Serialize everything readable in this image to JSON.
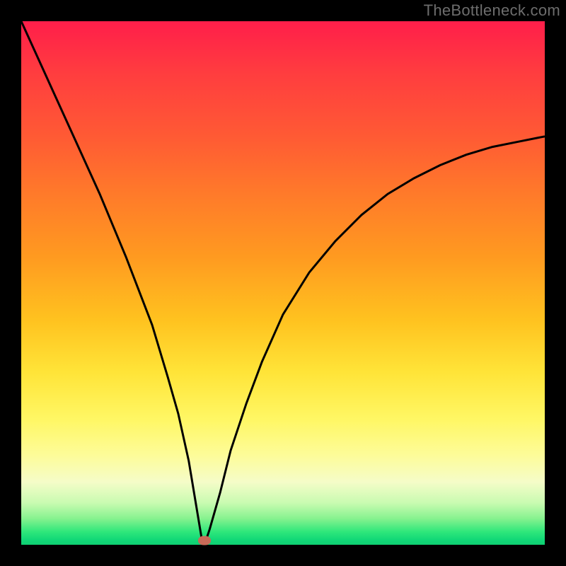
{
  "watermark": {
    "text": "TheBottleneck.com"
  },
  "colors": {
    "page_bg": "#000000",
    "watermark": "#6d6d6d",
    "curve": "#000000",
    "marker": "#c86a58",
    "gradient_top": "#ff1e4a",
    "gradient_bottom": "#0fcf72"
  },
  "chart_data": {
    "type": "line",
    "title": "",
    "xlabel": "",
    "ylabel": "",
    "xlim": [
      0,
      100
    ],
    "ylim": [
      0,
      100
    ],
    "grid": false,
    "legend": false,
    "series": [
      {
        "name": "curve",
        "x": [
          0,
          5,
          10,
          15,
          20,
          25,
          28,
          30,
          32,
          33,
          34,
          34.5,
          35,
          36,
          38,
          40,
          43,
          46,
          50,
          55,
          60,
          65,
          70,
          75,
          80,
          85,
          90,
          95,
          100
        ],
        "values": [
          100,
          89,
          78,
          67,
          55,
          42,
          32,
          25,
          16,
          10,
          4,
          1,
          0,
          3,
          10,
          18,
          27,
          35,
          44,
          52,
          58,
          63,
          67,
          70,
          72.5,
          74.5,
          76,
          77,
          78
        ]
      }
    ],
    "marker": {
      "x": 35,
      "y": 0.8
    }
  }
}
